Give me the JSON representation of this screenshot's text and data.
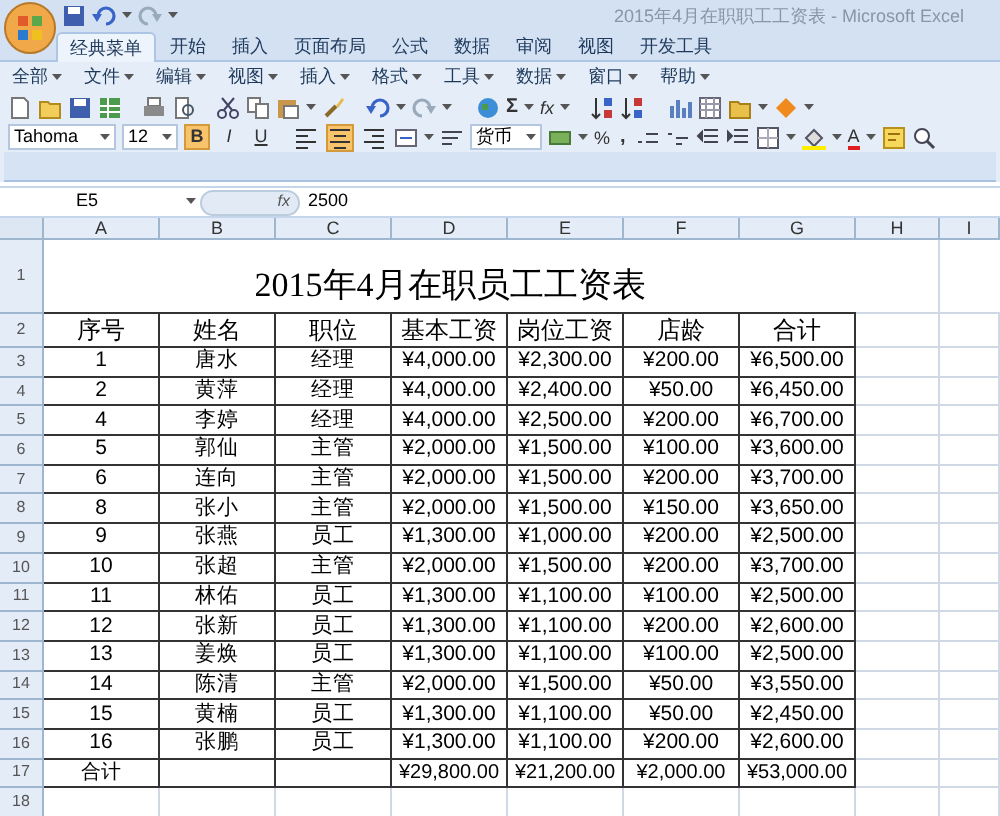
{
  "window": {
    "title": "2015年4月在职职工工资表 - Microsoft Excel"
  },
  "tabs": [
    {
      "label": "经典菜单",
      "selected": true
    },
    {
      "label": "开始",
      "selected": false
    },
    {
      "label": "插入",
      "selected": false
    },
    {
      "label": "页面布局",
      "selected": false
    },
    {
      "label": "公式",
      "selected": false
    },
    {
      "label": "数据",
      "selected": false
    },
    {
      "label": "审阅",
      "selected": false
    },
    {
      "label": "视图",
      "selected": false
    },
    {
      "label": "开发工具",
      "selected": false
    }
  ],
  "menu": [
    "全部",
    "文件",
    "编辑",
    "视图",
    "插入",
    "格式",
    "工具",
    "数据",
    "窗口",
    "帮助"
  ],
  "toolbar": {
    "sum_label": "Σ",
    "function_label": "fx",
    "font": "Tahoma",
    "font_size": "12",
    "number_format": "货币",
    "percent_label": "%",
    "comma_label": ",",
    "font_color_label": "A",
    "format_buttons": [
      {
        "label": "B",
        "selected": true
      },
      {
        "label": "I",
        "selected": false
      },
      {
        "label": "U",
        "selected": false
      }
    ],
    "align_buttons": [
      {
        "kind": "left",
        "selected": false
      },
      {
        "kind": "center",
        "selected": true
      },
      {
        "kind": "right",
        "selected": false
      }
    ]
  },
  "formula_bar": {
    "name_box": "E5",
    "function_label": "fx",
    "value": "2500"
  },
  "sheet": {
    "columns": [
      "A",
      "B",
      "C",
      "D",
      "E",
      "F",
      "G",
      "H",
      "I"
    ],
    "rows": [
      "1",
      "2",
      "3",
      "4",
      "5",
      "6",
      "7",
      "8",
      "9",
      "10",
      "11",
      "12",
      "13",
      "14",
      "15",
      "16",
      "17",
      "18"
    ],
    "title": "2015年4月在职员工工资表",
    "header": [
      "序号",
      "姓名",
      "职位",
      "基本工资",
      "岗位工资",
      "店龄",
      "合计"
    ],
    "records": [
      [
        "1",
        "唐水",
        "经理",
        "¥4,000.00",
        "¥2,300.00",
        "¥200.00",
        "¥6,500.00"
      ],
      [
        "2",
        "黄萍",
        "经理",
        "¥4,000.00",
        "¥2,400.00",
        "¥50.00",
        "¥6,450.00"
      ],
      [
        "4",
        "李婷",
        "经理",
        "¥4,000.00",
        "¥2,500.00",
        "¥200.00",
        "¥6,700.00"
      ],
      [
        "5",
        "郭仙",
        "主管",
        "¥2,000.00",
        "¥1,500.00",
        "¥100.00",
        "¥3,600.00"
      ],
      [
        "6",
        "连向",
        "主管",
        "¥2,000.00",
        "¥1,500.00",
        "¥200.00",
        "¥3,700.00"
      ],
      [
        "8",
        "张小",
        "主管",
        "¥2,000.00",
        "¥1,500.00",
        "¥150.00",
        "¥3,650.00"
      ],
      [
        "9",
        "张燕",
        "员工",
        "¥1,300.00",
        "¥1,000.00",
        "¥200.00",
        "¥2,500.00"
      ],
      [
        "10",
        "张超",
        "主管",
        "¥2,000.00",
        "¥1,500.00",
        "¥200.00",
        "¥3,700.00"
      ],
      [
        "11",
        "林佑",
        "员工",
        "¥1,300.00",
        "¥1,100.00",
        "¥100.00",
        "¥2,500.00"
      ],
      [
        "12",
        "张新",
        "员工",
        "¥1,300.00",
        "¥1,100.00",
        "¥200.00",
        "¥2,600.00"
      ],
      [
        "13",
        "姜焕",
        "员工",
        "¥1,300.00",
        "¥1,100.00",
        "¥100.00",
        "¥2,500.00"
      ],
      [
        "14",
        "陈清",
        "主管",
        "¥2,000.00",
        "¥1,500.00",
        "¥50.00",
        "¥3,550.00"
      ],
      [
        "15",
        "黄楠",
        "员工",
        "¥1,300.00",
        "¥1,100.00",
        "¥50.00",
        "¥2,450.00"
      ],
      [
        "16",
        "张鹏",
        "员工",
        "¥1,300.00",
        "¥1,100.00",
        "¥200.00",
        "¥2,600.00"
      ]
    ],
    "total": {
      "label": "合计",
      "values": [
        "¥29,800.00",
        "¥21,200.00",
        "¥2,000.00",
        "¥53,000.00"
      ]
    }
  }
}
